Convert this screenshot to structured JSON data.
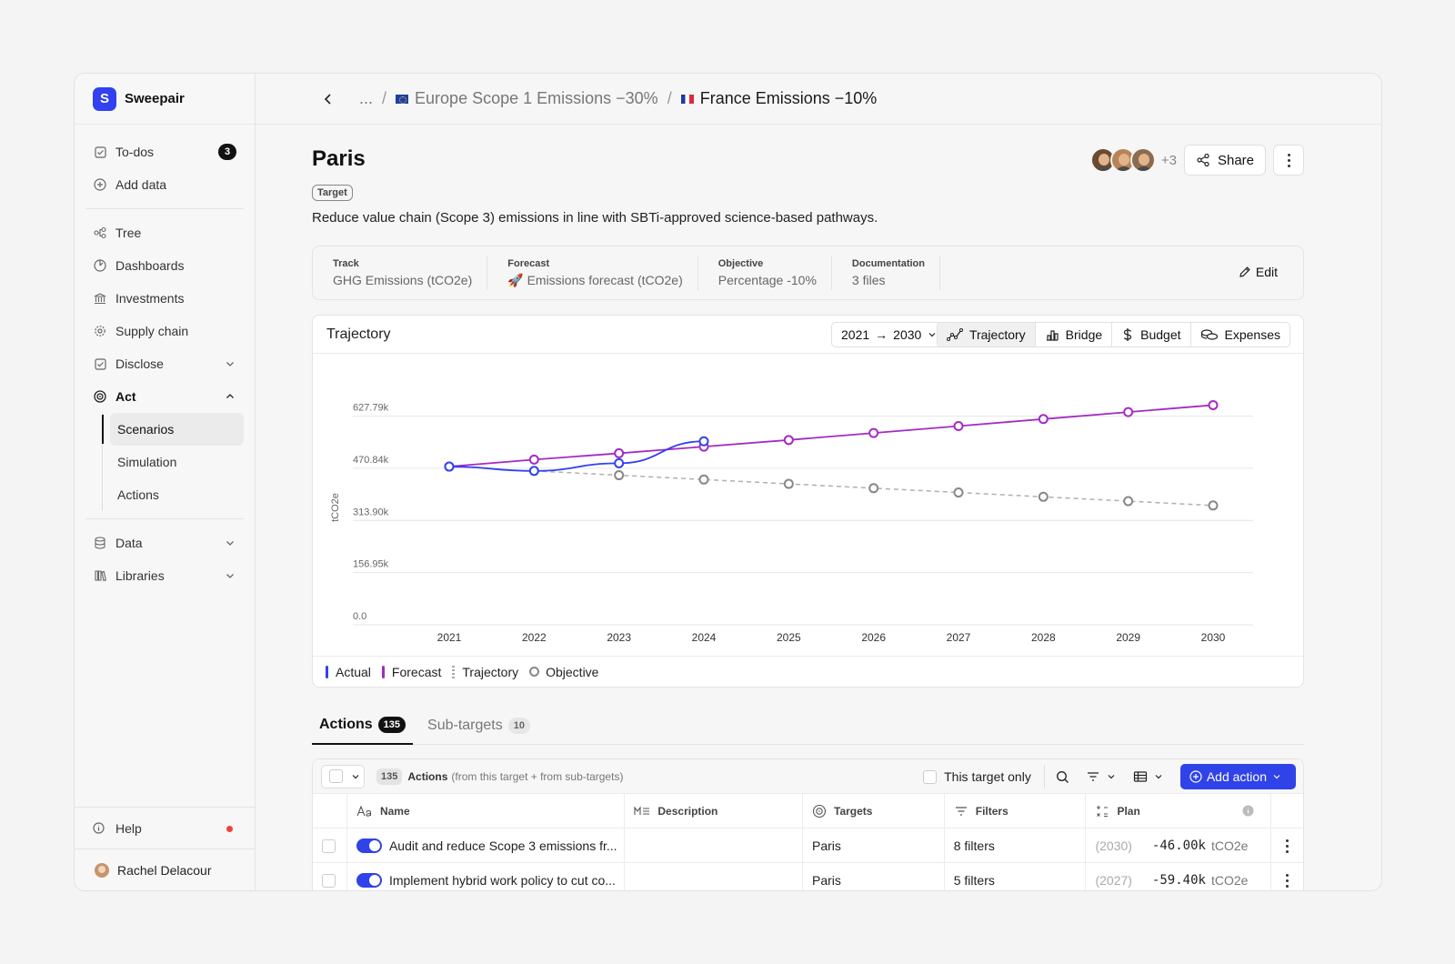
{
  "app": {
    "name": "Sweepair"
  },
  "sidebar": {
    "todos": {
      "label": "To-dos",
      "count": "3"
    },
    "add_data": "Add data",
    "items": [
      {
        "label": "Tree",
        "icon": "tree-icon"
      },
      {
        "label": "Dashboards",
        "icon": "dashboard-icon"
      },
      {
        "label": "Investments",
        "icon": "bank-icon"
      },
      {
        "label": "Supply chain",
        "icon": "gear-icon"
      },
      {
        "label": "Disclose",
        "icon": "checkbox-icon"
      },
      {
        "label": "Act",
        "icon": "target-icon"
      }
    ],
    "act_sub": [
      "Scenarios",
      "Simulation",
      "Actions"
    ],
    "data": "Data",
    "libraries": "Libraries",
    "help": "Help",
    "user": "Rachel Delacour"
  },
  "breadcrumb": {
    "ellipsis": "...",
    "separator": "/",
    "parent": "Europe Scope 1 Emissions −30%",
    "current": "France Emissions −10%"
  },
  "page": {
    "title": "Paris",
    "tag": "Target",
    "description": "Reduce value chain (Scope 3) emissions in line with SBTi-approved science-based pathways.",
    "avatars_more": "+3",
    "share": "Share"
  },
  "meta": {
    "track": {
      "label": "Track",
      "value": "GHG Emissions (tCO2e)"
    },
    "forecast": {
      "label": "Forecast",
      "value": "🚀 Emissions forecast (tCO2e)"
    },
    "objective": {
      "label": "Objective",
      "value": "Percentage -10%"
    },
    "documentation": {
      "label": "Documentation",
      "value": "3 files"
    },
    "edit": "Edit"
  },
  "chart_panel": {
    "title": "Trajectory",
    "range": {
      "from": "2021",
      "arrow": "→",
      "to": "2030"
    },
    "views": [
      "Trajectory",
      "Bridge",
      "Budget",
      "Expenses"
    ],
    "legend": [
      "Actual",
      "Forecast",
      "Trajectory",
      "Objective"
    ]
  },
  "chart_data": {
    "type": "line",
    "x": [
      2021,
      2022,
      2023,
      2024,
      2025,
      2026,
      2027,
      2028,
      2029,
      2030
    ],
    "ylabel": "tCO2e",
    "yticks": [
      "0.0",
      "156.95k",
      "313.90k",
      "470.84k",
      "627.79k"
    ],
    "ylim": [
      0,
      706000
    ],
    "grid": true,
    "legend_position": "bottom-left",
    "series": [
      {
        "name": "Actual",
        "color": "#3141f0",
        "x": [
          2021,
          2022,
          2023,
          2024
        ],
        "values": [
          476000,
          463000,
          486000,
          552000
        ]
      },
      {
        "name": "Forecast",
        "color": "#a42bc4",
        "x": [
          2021,
          2022,
          2023,
          2024,
          2025,
          2026,
          2027,
          2028,
          2029,
          2030
        ],
        "values": [
          476000,
          497000,
          516000,
          536000,
          556000,
          577000,
          598000,
          619000,
          640000,
          661000
        ]
      },
      {
        "name": "Trajectory",
        "color": "#b0b0b0",
        "x": [
          2022,
          2023,
          2024,
          2025,
          2026,
          2027,
          2028,
          2029,
          2030
        ],
        "values": [
          463000,
          450000,
          437000,
          424000,
          411000,
          398000,
          385000,
          372000,
          359000
        ]
      },
      {
        "name": "Objective",
        "color": "#888888",
        "x": [
          2023,
          2024,
          2025,
          2026,
          2027,
          2028,
          2029,
          2030
        ],
        "values": [
          450000,
          437000,
          424000,
          411000,
          398000,
          385000,
          372000,
          359000
        ]
      }
    ]
  },
  "tabs": [
    {
      "label": "Actions",
      "count": "135"
    },
    {
      "label": "Sub-targets",
      "count": "10"
    }
  ],
  "table": {
    "toolbar": {
      "count": "135",
      "label": "Actions",
      "sublabel": "(from this target + from sub-targets)",
      "this_target_only": "This target only",
      "add_action": "Add action"
    },
    "columns": [
      "Name",
      "Description",
      "Targets",
      "Filters",
      "Plan"
    ],
    "rows": [
      {
        "name": "Audit and reduce Scope 3 emissions fr...",
        "description": "",
        "target": "Paris",
        "filters": "8 filters",
        "plan_year": "(2030)",
        "plan_value": "-46.00k",
        "plan_unit": "tCO2e"
      },
      {
        "name": "Implement hybrid work policy to cut co...",
        "description": "",
        "target": "Paris",
        "filters": "5 filters",
        "plan_year": "(2027)",
        "plan_value": "-59.40k",
        "plan_unit": "tCO2e"
      }
    ]
  }
}
